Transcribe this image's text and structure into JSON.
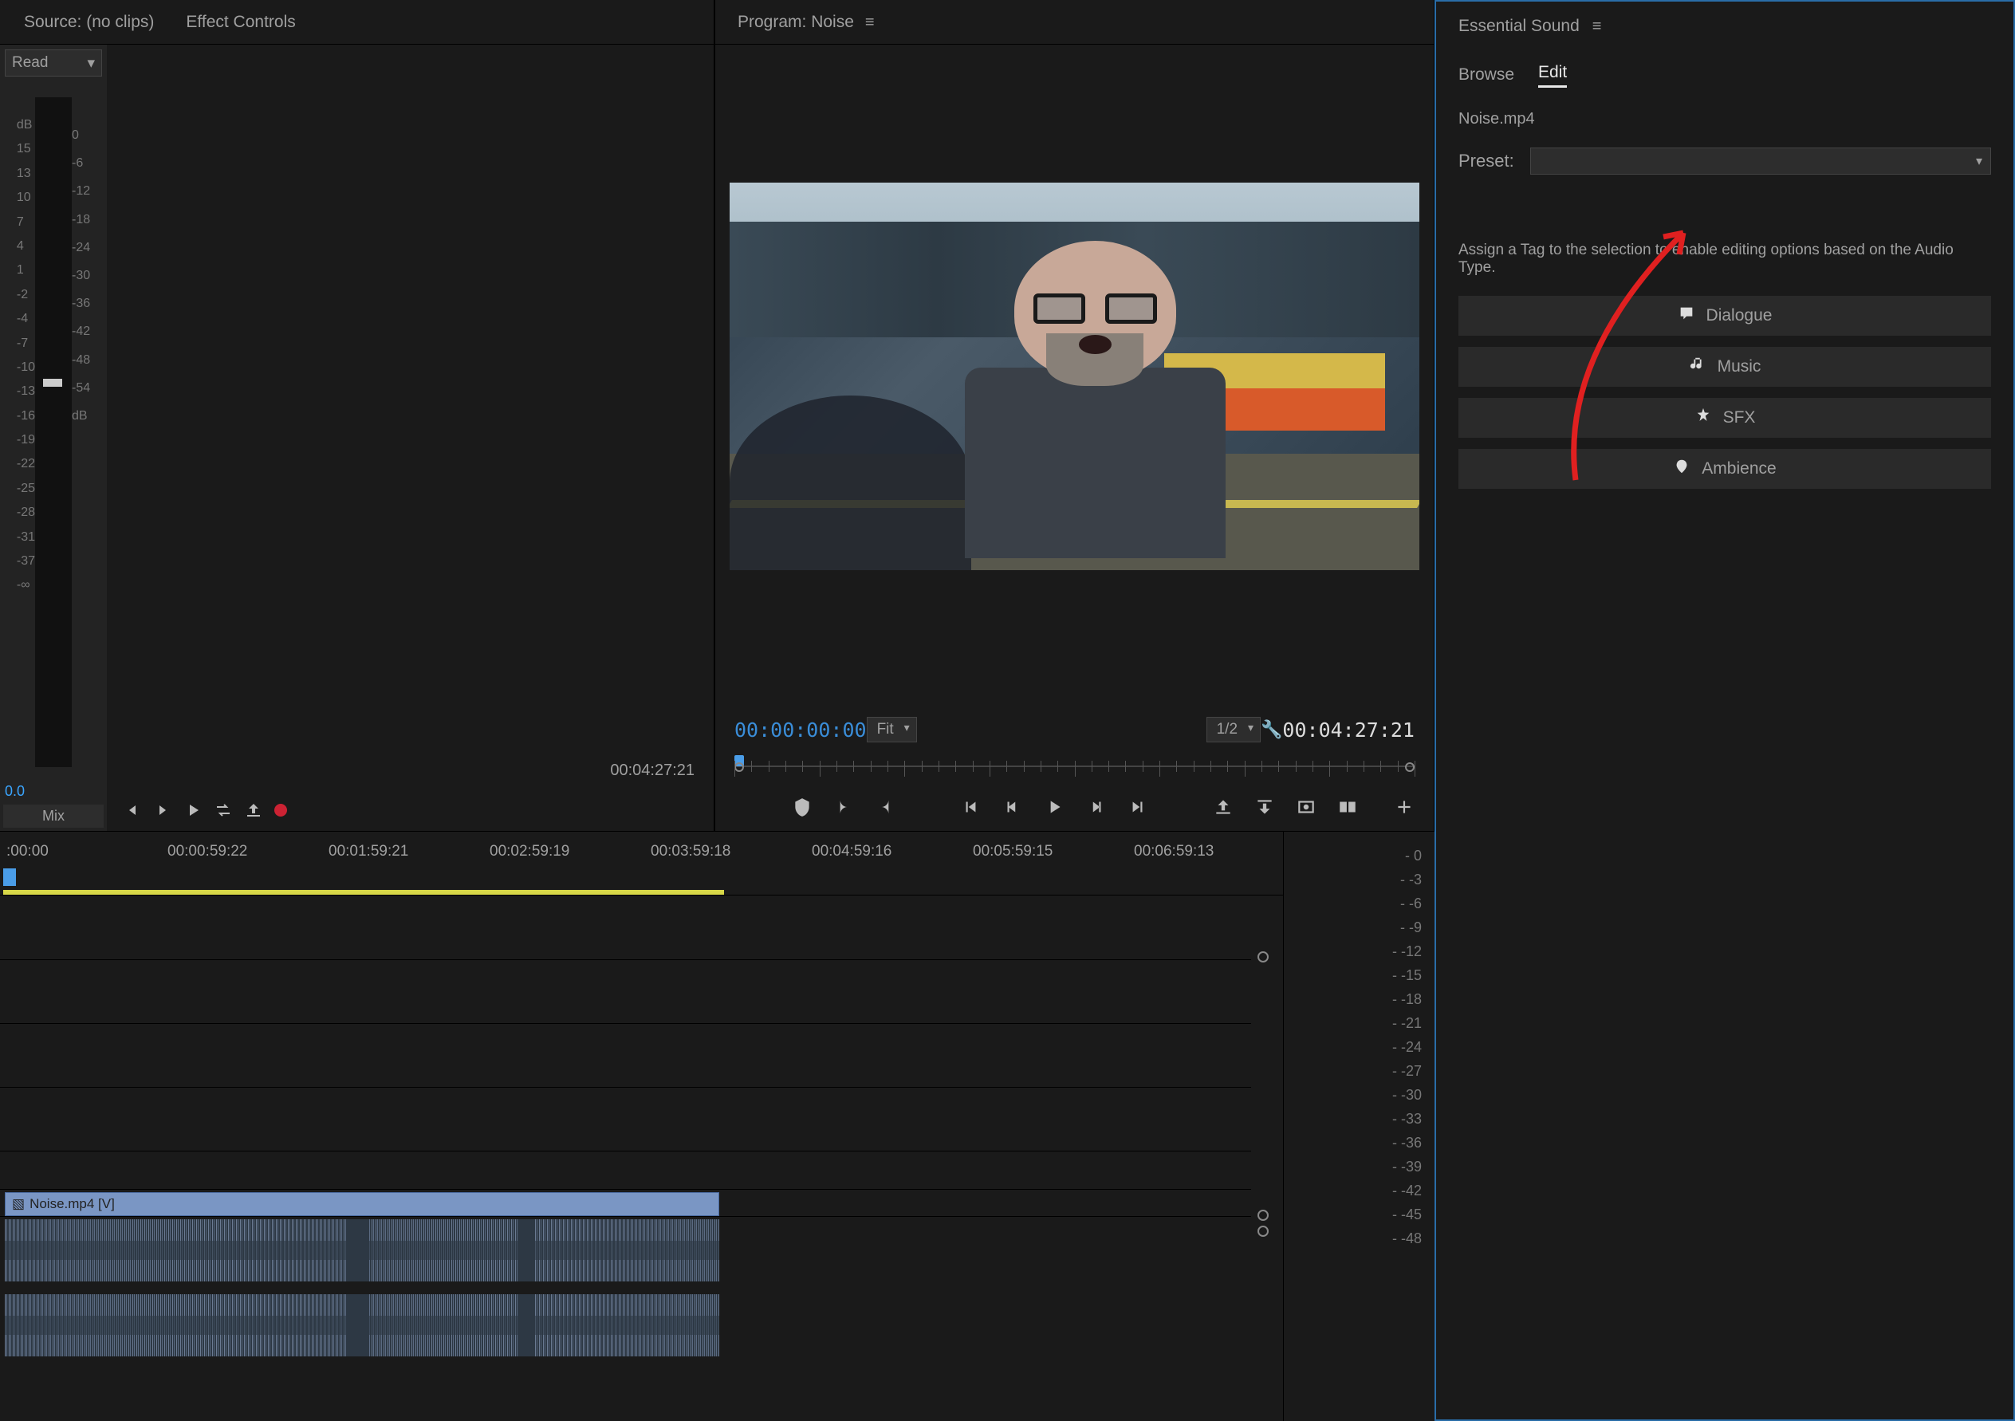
{
  "source": {
    "tab1": "Source: (no clips)",
    "tab2": "Effect Controls",
    "read_mode": "Read",
    "oo_val": "0.0",
    "mix": "Mix",
    "tc": "00:04:27:21",
    "db_left": [
      "dB",
      "15",
      "13",
      "10",
      "7",
      "4",
      "1",
      "-2",
      "-4",
      "-7",
      "-10",
      "-13",
      "-16",
      "-19",
      "-22",
      "-25",
      "-28",
      "-31",
      "-37",
      "-∞"
    ],
    "db_right": [
      "0",
      "-6",
      "-12",
      "-18",
      "-24",
      "-30",
      "-36",
      "-42",
      "-48",
      "-54",
      "dB"
    ]
  },
  "program": {
    "title": "Program: Noise",
    "playhead_tc": "00:00:00:00",
    "fit": "Fit",
    "res": "1/2",
    "duration_tc": "00:04:27:21"
  },
  "essential": {
    "title": "Essential Sound",
    "tab_browse": "Browse",
    "tab_edit": "Edit",
    "clip": "Noise.mp4",
    "preset_label": "Preset:",
    "hint": "Assign a Tag to the selection to enable editing options based on the Audio Type.",
    "tags": [
      {
        "icon": "dialogue-icon",
        "label": "Dialogue"
      },
      {
        "icon": "music-icon",
        "label": "Music"
      },
      {
        "icon": "sfx-icon",
        "label": "SFX"
      },
      {
        "icon": "ambience-icon",
        "label": "Ambience"
      }
    ]
  },
  "timeline": {
    "ruler": [
      ":00:00",
      "00:00:59:22",
      "00:01:59:21",
      "00:02:59:19",
      "00:03:59:18",
      "00:04:59:16",
      "00:05:59:15",
      "00:06:59:13"
    ],
    "vclip": "Noise.mp4 [V]",
    "db_scale": [
      "0",
      "-3",
      "-6",
      "-9",
      "-12",
      "-15",
      "-18",
      "-21",
      "-24",
      "-27",
      "-30",
      "-33",
      "-36",
      "-39",
      "-42",
      "-45",
      "-48"
    ]
  }
}
